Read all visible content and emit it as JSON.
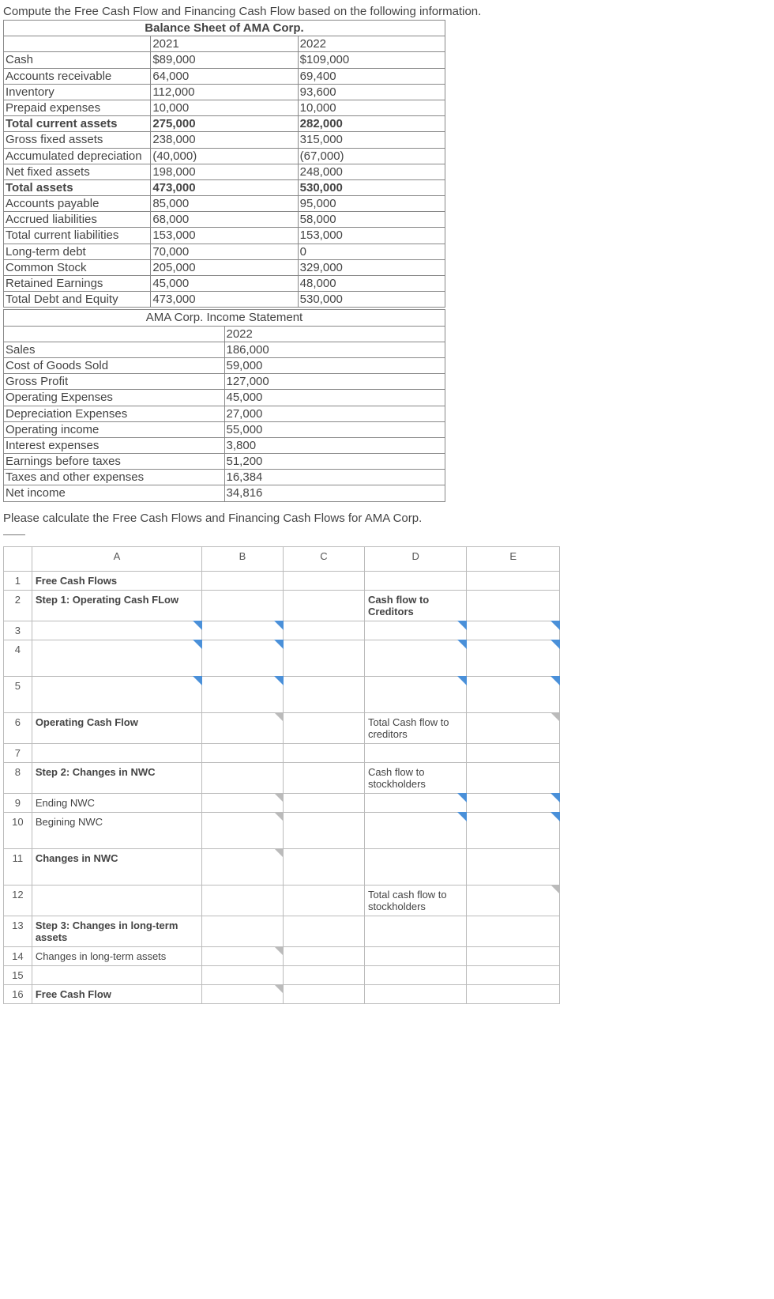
{
  "intro": "Compute the Free Cash Flow and Financing Cash Flow based on the following information.",
  "bs": {
    "title": "Balance Sheet of AMA Corp.",
    "years": {
      "y1": "2021",
      "y2": "2022"
    },
    "rows": {
      "cash": {
        "l": "Cash",
        "y1": "$89,000",
        "y2": "$109,000"
      },
      "ar": {
        "l": "Accounts receivable",
        "y1": "64,000",
        "y2": "69,400"
      },
      "inv": {
        "l": "Inventory",
        "y1": "112,000",
        "y2": "93,600"
      },
      "prep": {
        "l": "Prepaid expenses",
        "y1": "10,000",
        "y2": "10,000"
      },
      "tca": {
        "l": "Total current assets",
        "y1": "275,000",
        "y2": "282,000"
      },
      "gfa": {
        "l": "Gross fixed assets",
        "y1": "238,000",
        "y2": "315,000"
      },
      "adep": {
        "l": "Accumulated depreciation",
        "y1": "(40,000)",
        "y2": "(67,000)"
      },
      "nfa": {
        "l": "Net fixed assets",
        "y1": "198,000",
        "y2": "248,000"
      },
      "ta": {
        "l": "Total assets",
        "y1": "473,000",
        "y2": "530,000"
      },
      "ap": {
        "l": "Accounts payable",
        "y1": "85,000",
        "y2": "95,000"
      },
      "acl": {
        "l": "Accrued liabilities",
        "y1": "68,000",
        "y2": "58,000"
      },
      "tcl": {
        "l": "Total current liabilities",
        "y1": "153,000",
        "y2": "153,000"
      },
      "ltd": {
        "l": "Long-term debt",
        "y1": "70,000",
        "y2": "0"
      },
      "cs": {
        "l": "Common Stock",
        "y1": "205,000",
        "y2": "329,000"
      },
      "re": {
        "l": "Retained Earnings",
        "y1": "45,000",
        "y2": "48,000"
      },
      "tde": {
        "l": "Total Debt and Equity",
        "y1": "473,000",
        "y2": "530,000"
      }
    }
  },
  "is": {
    "title": "AMA Corp. Income Statement",
    "year": "2022",
    "rows": {
      "sales": {
        "l": "Sales",
        "v": "186,000"
      },
      "cogs": {
        "l": "Cost of Goods Sold",
        "v": "59,000"
      },
      "gp": {
        "l": "Gross Profit",
        "v": "127,000"
      },
      "opex": {
        "l": "Operating Expenses",
        "v": "45,000"
      },
      "dep": {
        "l": "Depreciation Expenses",
        "v": "27,000"
      },
      "opi": {
        "l": "Operating income",
        "v": "55,000"
      },
      "int": {
        "l": "Interest expenses",
        "v": "3,800"
      },
      "ebt": {
        "l": "Earnings before taxes",
        "v": "51,200"
      },
      "tax": {
        "l": "Taxes and other expenses",
        "v": "16,384"
      },
      "ni": {
        "l": "Net income",
        "v": "34,816"
      }
    }
  },
  "prompt": "Please calculate the Free Cash Flows and Financing Cash Flows for AMA Corp.",
  "g": {
    "cols": {
      "A": "A",
      "B": "B",
      "C": "C",
      "D": "D",
      "E": "E"
    },
    "r1A": "Free Cash Flows",
    "r2A": "Step 1: Operating Cash FLow",
    "r2D": "Cash flow to Creditors",
    "r6A": "Operating Cash Flow",
    "r6D": "Total Cash flow to creditors",
    "r8A": "Step 2: Changes in NWC",
    "r8D": "Cash flow to stockholders",
    "r9A": "Ending NWC",
    "r10A": "Begining NWC",
    "r11A": "Changes in NWC",
    "r12D": "Total cash flow to stockholders",
    "r13A": "Step 3: Changes in long-term assets",
    "r14A": "Changes in long-term assets",
    "r16A": "Free Cash Flow"
  }
}
